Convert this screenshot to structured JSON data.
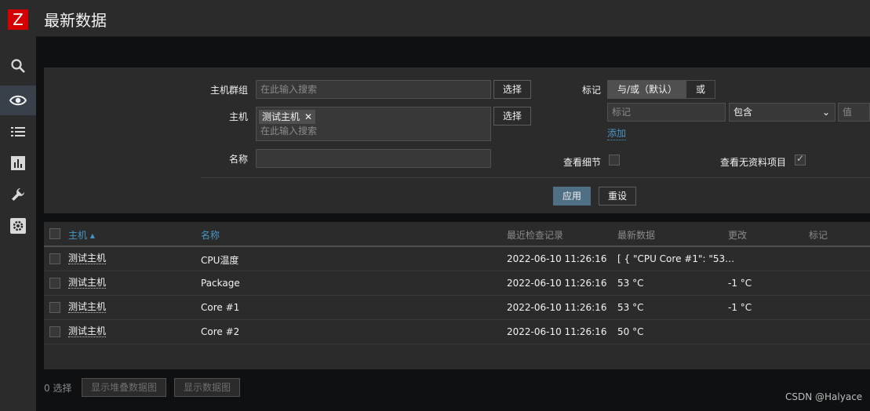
{
  "logo": {
    "letter": "Z"
  },
  "nav": [
    {
      "icon": "search-icon"
    },
    {
      "icon": "eye-icon"
    },
    {
      "icon": "list-icon"
    },
    {
      "icon": "chart-icon"
    },
    {
      "icon": "wrench-icon"
    },
    {
      "icon": "gear-icon"
    }
  ],
  "header": {
    "title": "最新数据"
  },
  "filter": {
    "host_group_label": "主机群组",
    "host_group_placeholder": "在此输入搜索",
    "select_label": "选择",
    "host_label": "主机",
    "host_chip": "测试主机",
    "host_placeholder": "在此输入搜索",
    "name_label": "名称",
    "tags_label": "标记",
    "toggle_and_or": "与/或（默认）",
    "toggle_or": "或",
    "tag_placeholder": "标记",
    "operator_value": "包含",
    "value_placeholder": "值",
    "add_link": "添加",
    "show_details_label": "查看细节",
    "show_details_checked": false,
    "show_without_data_label": "查看无资料项目",
    "show_without_data_checked": true,
    "apply_label": "应用",
    "reset_label": "重设"
  },
  "table": {
    "columns": {
      "host": "主机 ▴",
      "name": "名称",
      "last_check": "最近检查记录",
      "last_value": "最新数据",
      "change": "更改",
      "tags": "标记"
    },
    "rows": [
      {
        "host": "测试主机",
        "name": "CPU温度",
        "last_check": "2022-06-10 11:26:16",
        "last_value": "[ { \"CPU Core #1\": \"53…",
        "change": ""
      },
      {
        "host": "测试主机",
        "name": "Package",
        "last_check": "2022-06-10 11:26:16",
        "last_value": "53 °C",
        "change": "-1 °C"
      },
      {
        "host": "测试主机",
        "name": "Core #1",
        "last_check": "2022-06-10 11:26:16",
        "last_value": "53 °C",
        "change": "-1 °C"
      },
      {
        "host": "测试主机",
        "name": "Core #2",
        "last_check": "2022-06-10 11:26:16",
        "last_value": "50 °C",
        "change": ""
      }
    ]
  },
  "footer": {
    "selected_count": "0 选择",
    "stacked_graph_label": "显示堆叠数据图",
    "graph_label": "显示数据图"
  },
  "watermark": "CSDN @Halyace",
  "colors": {
    "accent": "#4796c4",
    "brand": "#d40000",
    "primary_button": "#4f6f84"
  }
}
